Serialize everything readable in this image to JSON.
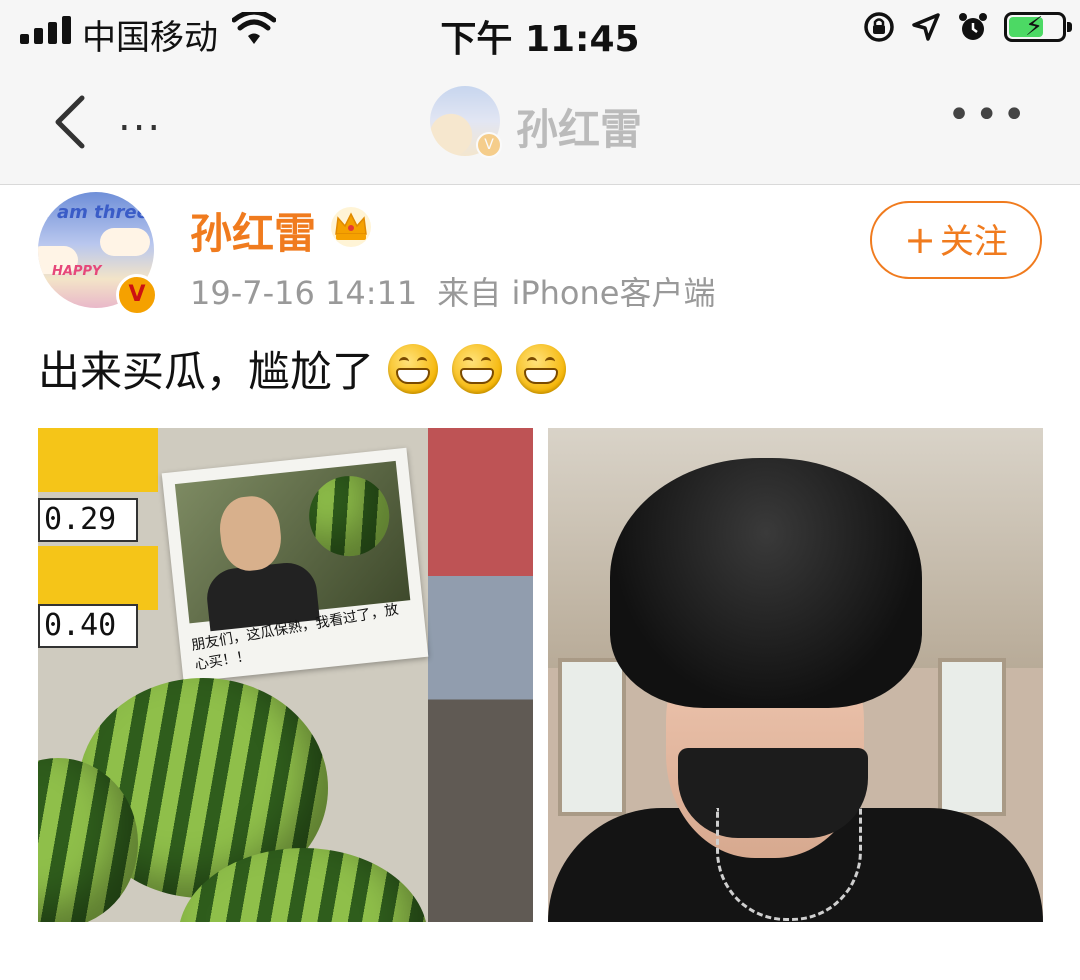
{
  "status_bar": {
    "carrier": "中国移动",
    "time": "下午 11:45",
    "icons": [
      "signal-icon",
      "wifi-icon",
      "rotation-lock-icon",
      "location-icon",
      "alarm-icon",
      "battery-charging-icon"
    ]
  },
  "nav": {
    "back_icon": "chevron-left-icon",
    "left_more": "...",
    "title": "孙红雷",
    "right_more": "•••"
  },
  "post": {
    "author": "孙红雷",
    "verified_badge": "V",
    "crown_icon": "crown-icon",
    "date": "19-7-16 14:11",
    "source": "来自 iPhone客户端",
    "follow_label": "关注",
    "follow_plus": "+",
    "text": "出来买瓜，尴尬了",
    "emojis": [
      "grin-emoji",
      "grin-emoji",
      "grin-emoji"
    ],
    "avatar_text": "I am three",
    "avatar_text2": "HAPPY",
    "photos": [
      {
        "name": "watermelon-stall-photo",
        "price_1": "0.29",
        "price_2": "0.40",
        "poster_caption": "朋友们，这瓜保熟，我看过了，放心买！！"
      },
      {
        "name": "selfie-bucket-hat-photo"
      }
    ]
  },
  "colors": {
    "accent": "#f07b1e",
    "meta_gray": "#999999",
    "bar_bg": "#f6f6f6"
  }
}
